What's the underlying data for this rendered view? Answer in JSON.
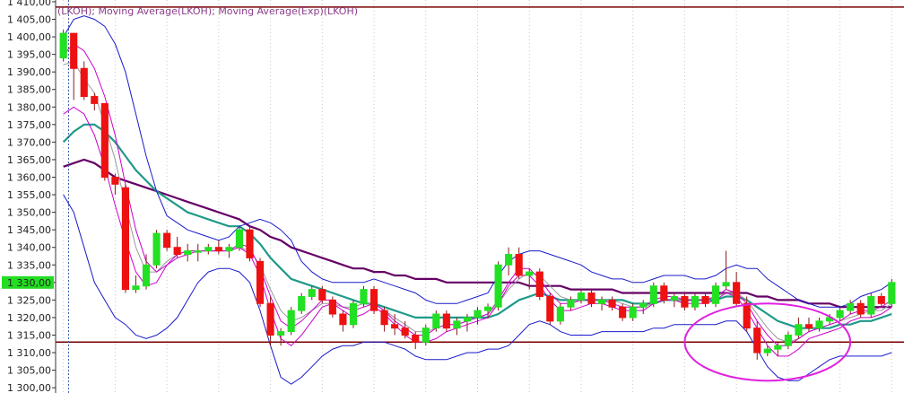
{
  "chart_data": {
    "type": "candlestick",
    "legend_text": "(LKOH); Moving Average(LKOH); Moving Average(Exp)(LKOH)",
    "ylim": [
      1298.5,
      1410.5
    ],
    "y_ticks": [
      1410,
      1405,
      1400,
      1395,
      1390,
      1385,
      1380,
      1375,
      1370,
      1365,
      1360,
      1355,
      1350,
      1345,
      1340,
      1335,
      1330,
      1325,
      1320,
      1315,
      1310,
      1305,
      1300
    ],
    "y_tick_labels": [
      "1 410,00",
      "1 405,00",
      "1 400,00",
      "1 395,00",
      "1 390,00",
      "1 385,00",
      "1 380,00",
      "1 375,00",
      "1 370,00",
      "1 365,00",
      "1 360,00",
      "1 355,00",
      "1 350,00",
      "1 345,00",
      "1 340,00",
      "1 335,00",
      "1 330,00",
      "1 325,00",
      "1 320,00",
      "1 315,00",
      "1 310,00",
      "1 305,00",
      "1 300,00"
    ],
    "last_price_label": "1 330,00",
    "horizontal_lines": [
      1408.5,
      1313.0
    ],
    "candles": [
      [
        1394,
        1402,
        1393,
        1401
      ],
      [
        1401,
        1401,
        1382,
        1391
      ],
      [
        1391,
        1393,
        1382,
        1383
      ],
      [
        1383,
        1384,
        1379,
        1381
      ],
      [
        1381,
        1381,
        1359,
        1360
      ],
      [
        1360,
        1361,
        1355,
        1358
      ],
      [
        1357,
        1358,
        1327,
        1328
      ],
      [
        1328,
        1332,
        1327,
        1329
      ],
      [
        1329,
        1338,
        1328,
        1335
      ],
      [
        1335,
        1345,
        1334,
        1344
      ],
      [
        1344,
        1345,
        1339,
        1340
      ],
      [
        1340,
        1343,
        1337,
        1338
      ],
      [
        1338,
        1341,
        1336,
        1339
      ],
      [
        1339,
        1341,
        1336,
        1339
      ],
      [
        1339,
        1341,
        1338,
        1340
      ],
      [
        1340,
        1342,
        1338,
        1339
      ],
      [
        1339,
        1341,
        1337,
        1340
      ],
      [
        1340,
        1346,
        1339,
        1345
      ],
      [
        1345,
        1346,
        1336,
        1337
      ],
      [
        1336,
        1337,
        1323,
        1324
      ],
      [
        1324,
        1326,
        1312,
        1315
      ],
      [
        1315,
        1317,
        1312,
        1316
      ],
      [
        1316,
        1323,
        1315,
        1322
      ],
      [
        1322,
        1327,
        1321,
        1326
      ],
      [
        1326,
        1329,
        1325,
        1328
      ],
      [
        1328,
        1329,
        1324,
        1325
      ],
      [
        1325,
        1326,
        1320,
        1321
      ],
      [
        1321,
        1322,
        1316,
        1318
      ],
      [
        1318,
        1325,
        1317,
        1324
      ],
      [
        1324,
        1329,
        1323,
        1328
      ],
      [
        1328,
        1329,
        1321,
        1322
      ],
      [
        1322,
        1323,
        1316,
        1318
      ],
      [
        1318,
        1321,
        1315,
        1317
      ],
      [
        1317,
        1319,
        1314,
        1315
      ],
      [
        1315,
        1316,
        1311,
        1313
      ],
      [
        1313,
        1318,
        1312,
        1317
      ],
      [
        1317,
        1322,
        1316,
        1321
      ],
      [
        1321,
        1322,
        1316,
        1317
      ],
      [
        1317,
        1320,
        1315,
        1319
      ],
      [
        1319,
        1321,
        1316,
        1320
      ],
      [
        1320,
        1323,
        1318,
        1322
      ],
      [
        1322,
        1324,
        1320,
        1323
      ],
      [
        1323,
        1336,
        1322,
        1335
      ],
      [
        1335,
        1340,
        1332,
        1338
      ],
      [
        1338,
        1340,
        1331,
        1332
      ],
      [
        1332,
        1334,
        1328,
        1333
      ],
      [
        1333,
        1334,
        1325,
        1326
      ],
      [
        1326,
        1327,
        1318,
        1319
      ],
      [
        1319,
        1324,
        1318,
        1323
      ],
      [
        1323,
        1326,
        1322,
        1325
      ],
      [
        1325,
        1328,
        1324,
        1327
      ],
      [
        1327,
        1328,
        1323,
        1324
      ],
      [
        1324,
        1326,
        1322,
        1325
      ],
      [
        1325,
        1326,
        1322,
        1323
      ],
      [
        1323,
        1324,
        1319,
        1320
      ],
      [
        1320,
        1324,
        1319,
        1323
      ],
      [
        1323,
        1325,
        1321,
        1324
      ],
      [
        1324,
        1330,
        1323,
        1329
      ],
      [
        1329,
        1330,
        1324,
        1325
      ],
      [
        1325,
        1327,
        1323,
        1326
      ],
      [
        1326,
        1327,
        1322,
        1323
      ],
      [
        1323,
        1327,
        1322,
        1326
      ],
      [
        1326,
        1327,
        1323,
        1324
      ],
      [
        1324,
        1330,
        1323,
        1329
      ],
      [
        1329,
        1339,
        1328,
        1330
      ],
      [
        1330,
        1333,
        1323,
        1324
      ],
      [
        1324,
        1326,
        1316,
        1317
      ],
      [
        1317,
        1319,
        1308,
        1310
      ],
      [
        1310,
        1312,
        1309,
        1311
      ],
      [
        1311,
        1313,
        1309,
        1312
      ],
      [
        1312,
        1316,
        1311,
        1315
      ],
      [
        1315,
        1320,
        1314,
        1318
      ],
      [
        1318,
        1320,
        1316,
        1317
      ],
      [
        1317,
        1320,
        1316,
        1319
      ],
      [
        1319,
        1321,
        1318,
        1320
      ],
      [
        1320,
        1323,
        1319,
        1322
      ],
      [
        1322,
        1325,
        1321,
        1324
      ],
      [
        1324,
        1325,
        1320,
        1321
      ],
      [
        1321,
        1327,
        1320,
        1326
      ],
      [
        1326,
        1327,
        1323,
        1324
      ],
      [
        1324,
        1331,
        1323,
        1330
      ]
    ],
    "series": [
      {
        "color": "#660066",
        "values": [
          1363,
          1364,
          1365,
          1364,
          1362,
          1360,
          1359,
          1358,
          1357,
          1356,
          1355,
          1354,
          1353,
          1352,
          1351,
          1350,
          1349,
          1348,
          1346,
          1345,
          1343,
          1342,
          1340,
          1339,
          1338,
          1337,
          1336,
          1335,
          1334,
          1334,
          1333,
          1333,
          1332,
          1332,
          1331,
          1331,
          1331,
          1330,
          1330,
          1330,
          1330,
          1330,
          1330,
          1330,
          1330,
          1329,
          1329,
          1329,
          1329,
          1328,
          1328,
          1328,
          1328,
          1328,
          1327,
          1327,
          1327,
          1327,
          1327,
          1327,
          1327,
          1327,
          1327,
          1327,
          1327,
          1327,
          1327,
          1326,
          1326,
          1325,
          1325,
          1325,
          1324,
          1324,
          1324,
          1323,
          1323,
          1323,
          1323,
          1323,
          1323
        ]
      },
      {
        "color": "#1f9a8a",
        "values": [
          1370,
          1373,
          1375,
          1375,
          1373,
          1370,
          1366,
          1362,
          1359,
          1356,
          1354,
          1352,
          1350,
          1349,
          1348,
          1347,
          1346,
          1346,
          1344,
          1341,
          1337,
          1334,
          1331,
          1330,
          1329,
          1328,
          1327,
          1326,
          1325,
          1324,
          1324,
          1323,
          1322,
          1321,
          1320,
          1320,
          1320,
          1320,
          1320,
          1320,
          1320,
          1320,
          1321,
          1323,
          1325,
          1326,
          1327,
          1326,
          1325,
          1325,
          1325,
          1325,
          1325,
          1325,
          1325,
          1324,
          1324,
          1324,
          1325,
          1325,
          1325,
          1325,
          1325,
          1325,
          1326,
          1326,
          1325,
          1323,
          1321,
          1319,
          1318,
          1317,
          1317,
          1317,
          1317,
          1318,
          1318,
          1319,
          1319,
          1320,
          1321
        ]
      },
      {
        "color": "#9a9a9a",
        "values": [
          1392,
          1393,
          1388,
          1384,
          1375,
          1365,
          1352,
          1340,
          1333,
          1333,
          1336,
          1338,
          1339,
          1339,
          1339,
          1339,
          1339,
          1340,
          1339,
          1335,
          1328,
          1322,
          1319,
          1320,
          1322,
          1324,
          1324,
          1323,
          1323,
          1324,
          1324,
          1322,
          1320,
          1318,
          1316,
          1316,
          1317,
          1318,
          1318,
          1319,
          1320,
          1321,
          1324,
          1328,
          1331,
          1333,
          1332,
          1329,
          1326,
          1325,
          1325,
          1325,
          1325,
          1325,
          1324,
          1323,
          1323,
          1324,
          1325,
          1325,
          1325,
          1325,
          1325,
          1326,
          1327,
          1327,
          1325,
          1321,
          1317,
          1314,
          1313,
          1314,
          1316,
          1317,
          1318,
          1319,
          1320,
          1321,
          1322,
          1322,
          1324
        ]
      },
      {
        "color": "#cc00cc",
        "values": [
          1395,
          1398,
          1396,
          1391,
          1383,
          1372,
          1358,
          1345,
          1336,
          1333,
          1335,
          1338,
          1339,
          1339,
          1339,
          1339,
          1339,
          1341,
          1340,
          1334,
          1326,
          1319,
          1317,
          1319,
          1322,
          1325,
          1325,
          1323,
          1322,
          1323,
          1324,
          1322,
          1319,
          1317,
          1315,
          1315,
          1317,
          1318,
          1318,
          1319,
          1320,
          1321,
          1325,
          1330,
          1334,
          1334,
          1331,
          1327,
          1324,
          1324,
          1325,
          1325,
          1325,
          1324,
          1323,
          1323,
          1323,
          1325,
          1326,
          1326,
          1325,
          1325,
          1325,
          1326,
          1328,
          1327,
          1324,
          1319,
          1315,
          1312,
          1312,
          1314,
          1316,
          1317,
          1318,
          1319,
          1321,
          1322,
          1322,
          1323,
          1325
        ]
      },
      {
        "color": "#1a1acc",
        "values": [
          1400,
          1405,
          1406,
          1405,
          1403,
          1398,
          1390,
          1378,
          1366,
          1356,
          1349,
          1347,
          1345,
          1344,
          1343,
          1342,
          1343,
          1346,
          1347,
          1348,
          1347,
          1345,
          1342,
          1336,
          1333,
          1331,
          1330,
          1330,
          1330,
          1330,
          1331,
          1330,
          1329,
          1328,
          1327,
          1325,
          1324,
          1324,
          1324,
          1325,
          1326,
          1327,
          1332,
          1336,
          1338,
          1339,
          1339,
          1338,
          1337,
          1336,
          1335,
          1333,
          1332,
          1331,
          1331,
          1330,
          1330,
          1331,
          1332,
          1332,
          1332,
          1331,
          1331,
          1332,
          1334,
          1335,
          1334,
          1334,
          1331,
          1329,
          1327,
          1325,
          1324,
          1323,
          1323,
          1323,
          1324,
          1326,
          1327,
          1328,
          1330
        ]
      },
      {
        "color": "#1a1acc",
        "values": [
          1355,
          1350,
          1340,
          1330,
          1325,
          1320,
          1318,
          1315,
          1314,
          1315,
          1317,
          1320,
          1325,
          1330,
          1333,
          1334,
          1334,
          1333,
          1330,
          1322,
          1312,
          1303,
          1301,
          1303,
          1306,
          1309,
          1311,
          1312,
          1312,
          1313,
          1313,
          1313,
          1312,
          1311,
          1309,
          1308,
          1308,
          1308,
          1309,
          1310,
          1310,
          1311,
          1311,
          1312,
          1315,
          1318,
          1319,
          1318,
          1316,
          1315,
          1315,
          1315,
          1316,
          1316,
          1316,
          1316,
          1316,
          1317,
          1317,
          1318,
          1318,
          1318,
          1318,
          1318,
          1319,
          1319,
          1316,
          1311,
          1306,
          1303,
          1302,
          1302,
          1304,
          1306,
          1308,
          1309,
          1309,
          1309,
          1309,
          1309,
          1310
        ]
      },
      {
        "color": "#cc00cc",
        "values": [
          1378,
          1380,
          1378,
          1372,
          1363,
          1352,
          1342,
          1333,
          1329,
          1330,
          1335,
          1337,
          1338,
          1339,
          1339,
          1339,
          1339,
          1340,
          1338,
          1332,
          1322,
          1314,
          1312,
          1315,
          1319,
          1323,
          1324,
          1322,
          1320,
          1321,
          1323,
          1321,
          1318,
          1315,
          1313,
          1313,
          1314,
          1316,
          1317,
          1318,
          1319,
          1320,
          1324,
          1329,
          1332,
          1332,
          1329,
          1325,
          1322,
          1322,
          1323,
          1324,
          1324,
          1323,
          1322,
          1322,
          1322,
          1324,
          1325,
          1325,
          1324,
          1324,
          1324,
          1325,
          1327,
          1326,
          1322,
          1317,
          1312,
          1309,
          1309,
          1311,
          1314,
          1315,
          1316,
          1317,
          1319,
          1320,
          1320,
          1321,
          1323
        ]
      }
    ],
    "ellipse_annotation": {
      "x_from": 60,
      "x_to": 76,
      "y_center": 1313,
      "y_radius": 11,
      "color": "#e020e0"
    },
    "marker_line_index": 0.5
  }
}
